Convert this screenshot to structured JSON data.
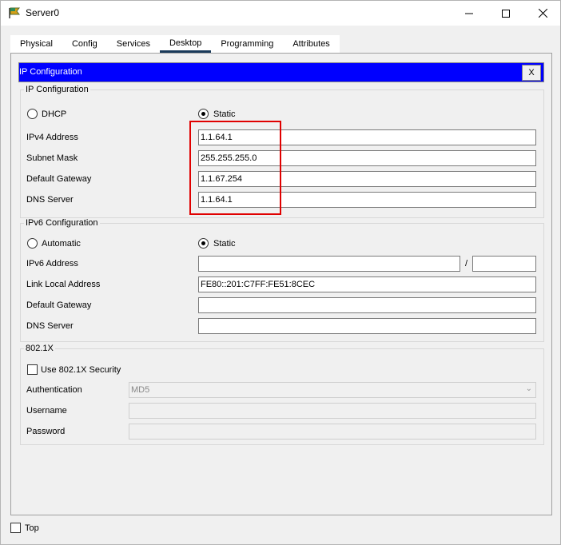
{
  "window": {
    "title": "Server0"
  },
  "tabs": [
    {
      "label": "Physical"
    },
    {
      "label": "Config"
    },
    {
      "label": "Services"
    },
    {
      "label": "Desktop"
    },
    {
      "label": "Programming"
    },
    {
      "label": "Attributes"
    }
  ],
  "active_tab": "Desktop",
  "ip_config": {
    "header": "IP Configuration",
    "close_label": "X",
    "ipv4": {
      "group_label": "IP Configuration",
      "dhcp_label": "DHCP",
      "static_label": "Static",
      "mode": "Static",
      "address_label": "IPv4 Address",
      "address": "1.1.64.1",
      "mask_label": "Subnet Mask",
      "mask": "255.255.255.0",
      "gateway_label": "Default Gateway",
      "gateway": "1.1.67.254",
      "dns_label": "DNS Server",
      "dns": "1.1.64.1"
    },
    "ipv6": {
      "group_label": "IPv6 Configuration",
      "automatic_label": "Automatic",
      "static_label": "Static",
      "mode": "Static",
      "address_label": "IPv6 Address",
      "address": "",
      "slash": "/",
      "prefix": "",
      "link_local_label": "Link Local Address",
      "link_local": "FE80::201:C7FF:FE51:8CEC",
      "gateway_label": "Default Gateway",
      "gateway": "",
      "dns_label": "DNS Server",
      "dns": ""
    },
    "dot1x": {
      "group_label": "802.1X",
      "use_label": "Use 802.1X Security",
      "use_checked": false,
      "auth_label": "Authentication",
      "auth_value": "MD5",
      "username_label": "Username",
      "username": "",
      "password_label": "Password",
      "password": ""
    }
  },
  "footer": {
    "top_label": "Top",
    "top_checked": false
  },
  "colors": {
    "header_bg": "#0000ff",
    "highlight": "#e00000"
  }
}
